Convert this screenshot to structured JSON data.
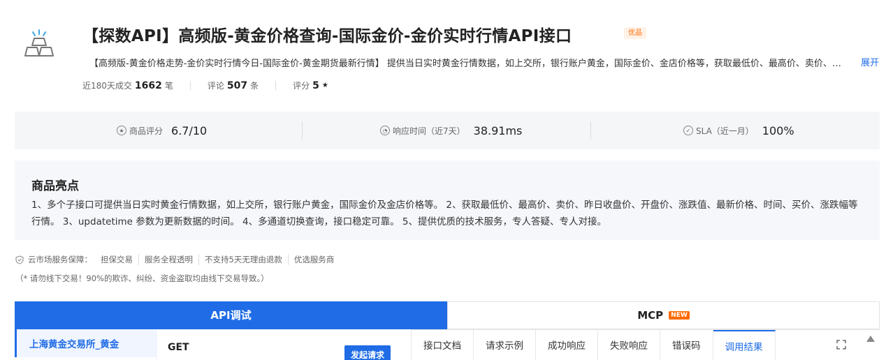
{
  "header": {
    "title": "【探数API】高频版-黄金价格查询-国际金价-金价实时行情API接口",
    "badge": "优品",
    "description": "【高频版-黄金价格走势-金价实时行情今日-国际金价-黄金期货最新行情】 提供当日实时黄金行情数据，如上交所，银行账户黄金，国际金价、金店价格等，获取最低价、最高价、卖价、昨日收盘价、开盘价",
    "expand_label": "展开",
    "stats": {
      "deals_label": "近180天成交",
      "deals_value": "1662",
      "deals_unit": "笔",
      "reviews_label": "评论",
      "reviews_value": "507",
      "reviews_unit": "条",
      "rating_label": "评分",
      "rating_value": "5",
      "rating_star": "★"
    }
  },
  "metrics": [
    {
      "icon": "star-circle-icon",
      "label": "商品评分",
      "value": "6.7/10"
    },
    {
      "icon": "clock-icon",
      "label": "响应时间（近7天）",
      "value": "38.91ms"
    },
    {
      "icon": "check-circle-icon",
      "label": "SLA（近一月）",
      "value": "100%"
    }
  ],
  "highlights": {
    "title": "商品亮点",
    "body": "1、多个子接口可提供当日实时黄金行情数据，如上交所，银行账户黄金，国际金价及金店价格等。 2、获取最低价、最高价、卖价、昨日收盘价、开盘价、涨跌值、最新价格、时间、买价、涨跌幅等行情。 3、updatetime 参数为更新数据的时间。 4、多通道切换查询，接口稳定可靠。 5、提供优质的技术服务，专人答疑、专人对接。"
  },
  "guarantee": {
    "label": "云市场服务保障：",
    "items": [
      "担保交易",
      "服务全程透明",
      "不支持5天无理由退款",
      "优选服务商"
    ],
    "warning": "（* 请勿线下交易！90%的欺诈、纠纷、资金盗取均由线下交易导致。）"
  },
  "tabs": {
    "api": "API调试",
    "mcp": "MCP",
    "mcp_badge": "NEW"
  },
  "debug": {
    "left_item": "上海黄金交易所_黄金",
    "method": "GET",
    "send_label": "发起请求",
    "doc_tabs": [
      "接口文档",
      "请求示例",
      "成功响应",
      "失败响应",
      "错误码",
      "调用结果"
    ]
  },
  "colors": {
    "primary": "#1f6ce6",
    "accent": "#ff6a00",
    "panel_bg": "#f5f6f8"
  }
}
